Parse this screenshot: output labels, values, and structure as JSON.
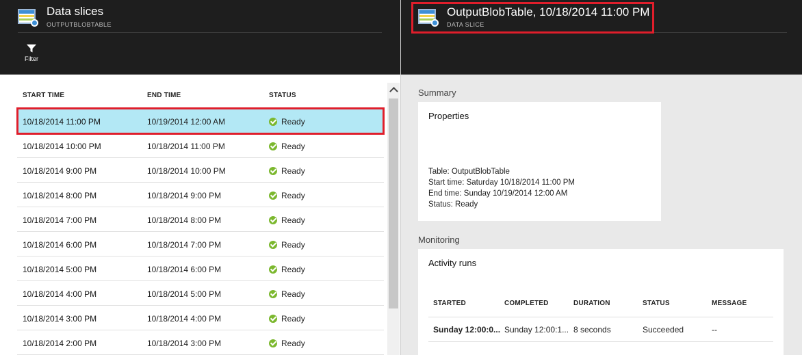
{
  "left": {
    "title": "Data slices",
    "subtitle": "OUTPUTBLOBTABLE",
    "filter_label": "Filter",
    "columns": [
      "START TIME",
      "END TIME",
      "STATUS"
    ],
    "rows": [
      {
        "start": "10/18/2014 11:00 PM",
        "end": "10/19/2014 12:00 AM",
        "status": "Ready"
      },
      {
        "start": "10/18/2014 10:00 PM",
        "end": "10/18/2014 11:00 PM",
        "status": "Ready"
      },
      {
        "start": "10/18/2014 9:00 PM",
        "end": "10/18/2014 10:00 PM",
        "status": "Ready"
      },
      {
        "start": "10/18/2014 8:00 PM",
        "end": "10/18/2014 9:00 PM",
        "status": "Ready"
      },
      {
        "start": "10/18/2014 7:00 PM",
        "end": "10/18/2014 8:00 PM",
        "status": "Ready"
      },
      {
        "start": "10/18/2014 6:00 PM",
        "end": "10/18/2014 7:00 PM",
        "status": "Ready"
      },
      {
        "start": "10/18/2014 5:00 PM",
        "end": "10/18/2014 6:00 PM",
        "status": "Ready"
      },
      {
        "start": "10/18/2014 4:00 PM",
        "end": "10/18/2014 5:00 PM",
        "status": "Ready"
      },
      {
        "start": "10/18/2014 3:00 PM",
        "end": "10/18/2014 4:00 PM",
        "status": "Ready"
      },
      {
        "start": "10/18/2014 2:00 PM",
        "end": "10/18/2014 3:00 PM",
        "status": "Ready"
      }
    ]
  },
  "right": {
    "title": "OutputBlobTable, 10/18/2014 11:00 PM",
    "subtitle": "DATA SLICE",
    "summary_label": "Summary",
    "properties": {
      "title": "Properties",
      "lines": [
        "Table: OutputBlobTable",
        "Start time: Saturday 10/18/2014 11:00 PM",
        "End time: Sunday 10/19/2014 12:00 AM",
        "Status: Ready"
      ]
    },
    "monitoring_label": "Monitoring",
    "activity_runs": {
      "title": "Activity runs",
      "columns": [
        "STARTED",
        "COMPLETED",
        "DURATION",
        "STATUS",
        "MESSAGE"
      ],
      "rows": [
        {
          "started": "Sunday 12:00:0...",
          "completed": "Sunday 12:00:1...",
          "duration": "8 seconds",
          "status": "Succeeded",
          "message": "--"
        }
      ]
    }
  },
  "colors": {
    "header_bg": "#1e1e1e",
    "selected_row": "#b3e8f5",
    "highlight_border": "#e01e2b",
    "ready_green": "#7cb82f",
    "right_bg": "#e9e9e9"
  },
  "icons": [
    "data-table-icon",
    "filter-icon",
    "ready-check-icon",
    "scroll-up-icon"
  ]
}
